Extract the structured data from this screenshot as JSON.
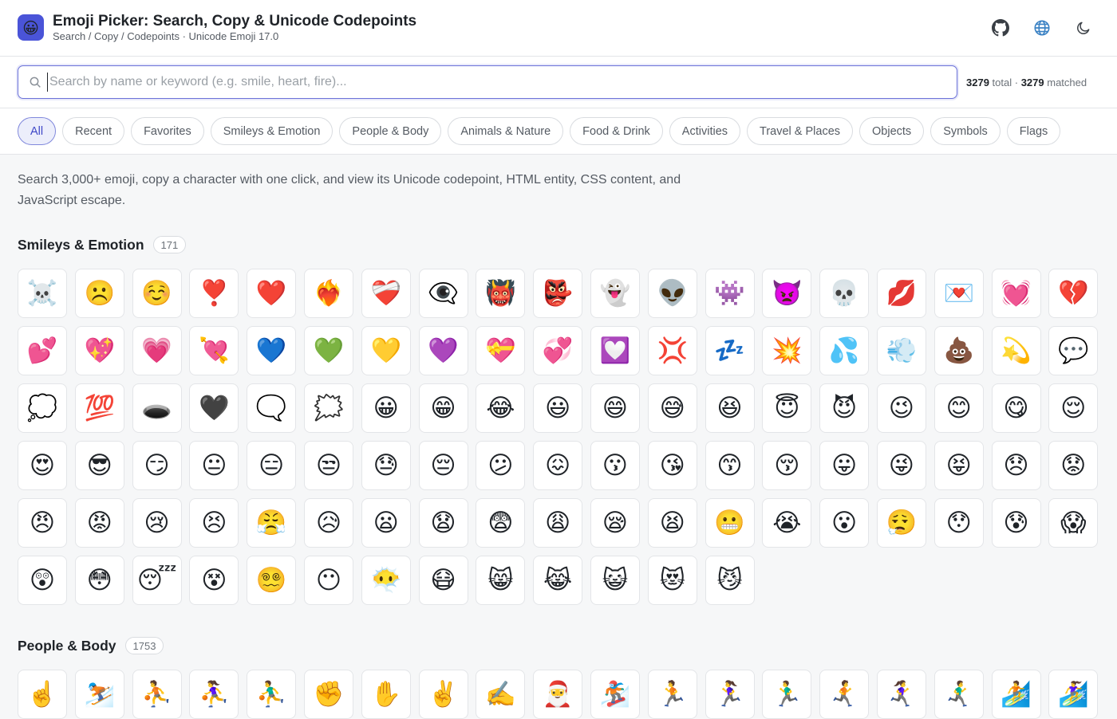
{
  "header": {
    "logo_emoji": "😀",
    "title": "Emoji Picker: Search, Copy & Unicode Codepoints",
    "subtitle": "Search / Copy / Codepoints · Unicode Emoji 17.0",
    "icons": [
      "github-icon",
      "globe-icon",
      "moon-icon"
    ]
  },
  "search": {
    "placeholder": "Search by name or keyword (e.g. smile, heart, fire)...",
    "value": "",
    "total": "3279",
    "total_label": "total ·",
    "matched": "3279",
    "matched_label": "matched"
  },
  "tabs": [
    {
      "label": "All",
      "active": true
    },
    {
      "label": "Recent"
    },
    {
      "label": "Favorites"
    },
    {
      "label": "Smileys & Emotion"
    },
    {
      "label": "People & Body"
    },
    {
      "label": "Animals & Nature"
    },
    {
      "label": "Food & Drink"
    },
    {
      "label": "Activities"
    },
    {
      "label": "Travel & Places"
    },
    {
      "label": "Objects"
    },
    {
      "label": "Symbols"
    },
    {
      "label": "Flags"
    }
  ],
  "intro": "Search 3,000+ emoji, copy a character with one click, and view its Unicode codepoint, HTML entity, CSS content, and JavaScript escape.",
  "sections": [
    {
      "name": "Smileys & Emotion",
      "count": "171",
      "emojis": [
        "☠️",
        "☹️",
        "☺️",
        "❣️",
        "❤️",
        "❤️‍🔥",
        "❤️‍🩹",
        "👁️‍🗨️",
        "👹",
        "👺",
        "👻",
        "👽",
        "👾",
        "👿",
        "💀",
        "💋",
        "💌",
        "💓",
        "💔",
        "💕",
        "💖",
        "💗",
        "💘",
        "💙",
        "💚",
        "💛",
        "💜",
        "💝",
        "💞",
        "💟",
        "💢",
        "💤",
        "💥",
        "💦",
        "💨",
        "💩",
        "💫",
        "💬",
        "💭",
        "💯",
        "🕳️",
        "🖤",
        "🗨️",
        "🗯️",
        "😀",
        "😁",
        "😂",
        "😃",
        "😄",
        "😅",
        "😆",
        "😇",
        "😈",
        "😉",
        "😊",
        "😋",
        "😌",
        "😍",
        "😎",
        "😏",
        "😐",
        "😑",
        "😒",
        "😓",
        "😔",
        "😕",
        "😖",
        "😗",
        "😘",
        "😙",
        "😚",
        "😛",
        "😜",
        "😝",
        "😞",
        "😟",
        "😠",
        "😡",
        "😢",
        "😣",
        "😤",
        "😥",
        "😦",
        "😧",
        "😨",
        "😩",
        "😪",
        "😫",
        "😬",
        "😭",
        "😮",
        "😮‍💨",
        "😯",
        "😰",
        "😱",
        "😲",
        "😳",
        "😴",
        "😵",
        "😵‍💫",
        "😶",
        "😶‍🌫️",
        "😷",
        "😸",
        "😹",
        "😺",
        "😻",
        "😼"
      ]
    },
    {
      "name": "People & Body",
      "count": "1753",
      "emojis": [
        "☝️",
        "⛷️",
        "⛹️",
        "⛹️‍♀️",
        "⛹️‍♂️",
        "✊",
        "✋",
        "✌️",
        "✍️",
        "🎅",
        "🏂",
        "🏃",
        "🏃‍♀️",
        "🏃‍♂️",
        "🏃‍➡️",
        "🏃‍♀️‍➡️",
        "🏃‍♂️‍➡️",
        "🏄",
        "🏄‍♀️"
      ]
    }
  ]
}
